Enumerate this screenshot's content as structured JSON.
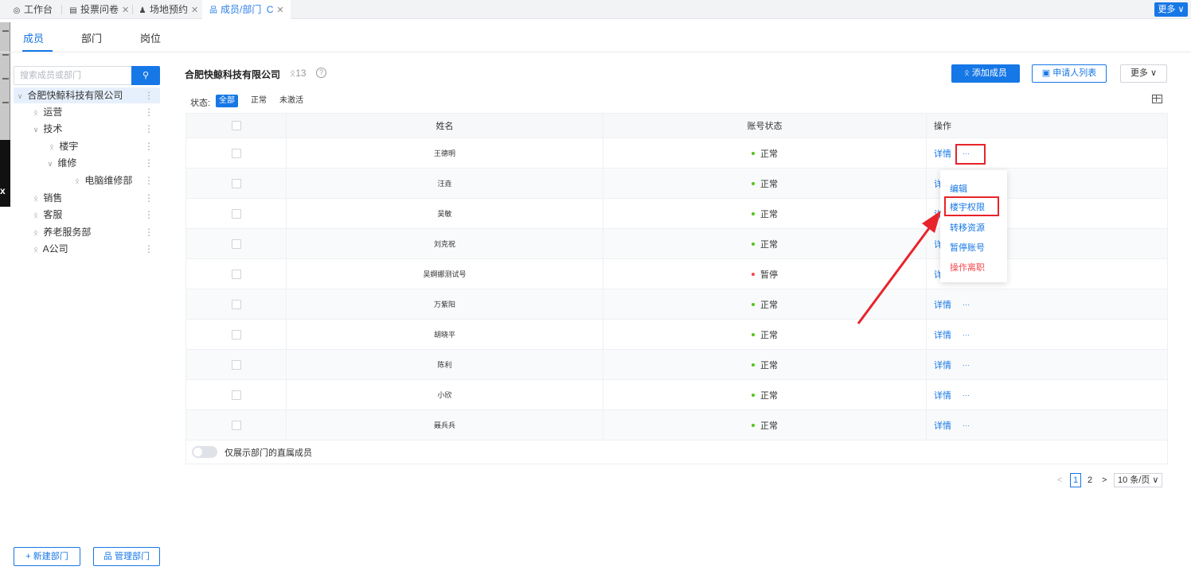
{
  "top_tabs": [
    {
      "icon": "◎",
      "label": "工作台",
      "closable": false
    },
    {
      "icon": "▤",
      "label": "投票问卷",
      "closable": true
    },
    {
      "icon": "♟",
      "label": "场地预约",
      "closable": true
    },
    {
      "icon": "品",
      "label": "成员/部门",
      "closable": true,
      "refresh": "C",
      "active": true
    }
  ],
  "top_more": "更多 ∨",
  "sub_tabs": [
    "成员",
    "部门",
    "岗位"
  ],
  "sidebar": {
    "search_placeholder": "搜索成员或部门",
    "search_icon": "⚲",
    "tree": [
      {
        "label": "合肥快鲸科技有限公司",
        "arrow": "∨",
        "selected": true
      },
      {
        "label": "运营",
        "person": "ᛟ"
      },
      {
        "label": "技术",
        "arrow": "∨"
      },
      {
        "label": "楼宇",
        "person": "ᛟ"
      },
      {
        "label": "维修",
        "arrow": "∨"
      },
      {
        "label": "电脑维修部",
        "person": "ᛟ"
      },
      {
        "label": "销售",
        "person": "ᛟ"
      },
      {
        "label": "客服",
        "person": "ᛟ"
      },
      {
        "label": "养老服务部",
        "person": "ᛟ"
      },
      {
        "label": "A公司",
        "person": "ᛟ"
      }
    ],
    "tree_more": "⋮",
    "new_dept": "+ 新建部门",
    "manage_dept": "品 管理部门"
  },
  "header": {
    "company": "合肥快鲸科技有限公司",
    "count": "ᛟ13",
    "help": "?",
    "add_member": "ᛟ 添加成员",
    "applicants": "▣ 申请人列表",
    "more": "更多 ∨"
  },
  "status_filter": {
    "label": "状态:",
    "options": [
      "全部",
      "正常",
      "未激活"
    ],
    "active": "全部"
  },
  "table": {
    "columns": [
      "姓名",
      "账号状态",
      "操作"
    ],
    "rows": [
      {
        "name": "王德明",
        "status": "正常",
        "status_color": "#52c41a"
      },
      {
        "name": "汪垚",
        "status": "正常",
        "status_color": "#52c41a"
      },
      {
        "name": "吴敏",
        "status": "正常",
        "status_color": "#52c41a"
      },
      {
        "name": "刘克祝",
        "status": "正常",
        "status_color": "#52c41a"
      },
      {
        "name": "吴婀娜测试号",
        "status": "暂停",
        "status_color": "#f5474b"
      },
      {
        "name": "万紫阳",
        "status": "正常",
        "status_color": "#52c41a"
      },
      {
        "name": "胡晓平",
        "status": "正常",
        "status_color": "#52c41a"
      },
      {
        "name": "陈利",
        "status": "正常",
        "status_color": "#52c41a"
      },
      {
        "name": "小欣",
        "status": "正常",
        "status_color": "#52c41a"
      },
      {
        "name": "聂兵兵",
        "status": "正常",
        "status_color": "#52c41a"
      }
    ],
    "detail_label": "详情",
    "detail_partial": "详",
    "ellipsis": "···",
    "footer_toggle_label": "仅展示部门的直属成员"
  },
  "action_menu": {
    "items": [
      "编辑",
      "楼宇权限",
      "转移资源",
      "暂停账号",
      "操作离职"
    ]
  },
  "pagination": {
    "prev": "<",
    "pages": [
      "1",
      "2"
    ],
    "current": "1",
    "next": ">",
    "page_size": "10 条/页 ∨"
  },
  "colors": {
    "primary": "#1677e6",
    "danger": "#f5474b",
    "ok": "#52c41a",
    "annotation": "#e8232a"
  }
}
